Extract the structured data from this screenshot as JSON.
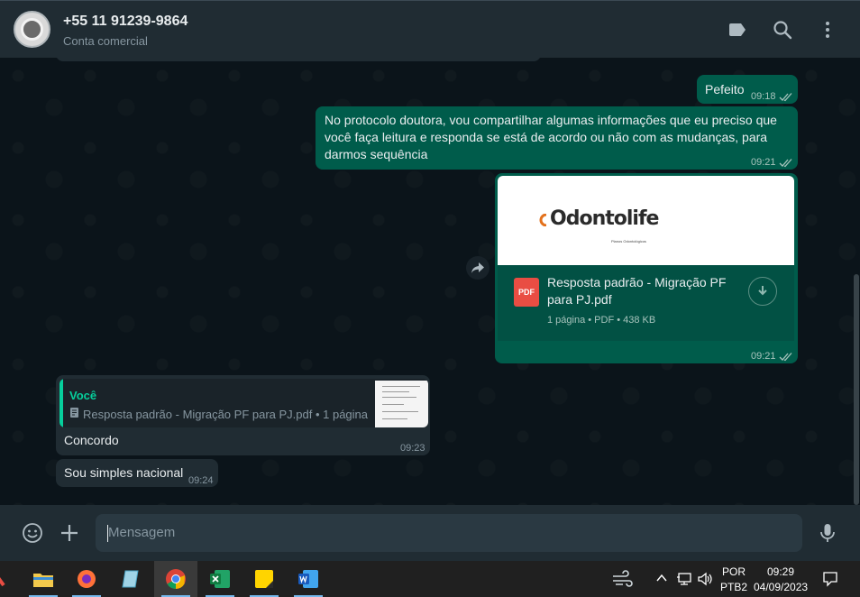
{
  "header": {
    "contact_name": "+55 11 91239-9864",
    "contact_subtitle": "Conta comercial",
    "icons": [
      "label-icon",
      "search-icon",
      "menu-icon"
    ]
  },
  "messages": {
    "m1": {
      "text": "Pefeito",
      "time": "09:18"
    },
    "m2": {
      "text": "No protocolo doutora, vou compartilhar algumas informações que eu preciso que você faça leitura e responda se está de acordo ou não com as mudanças, para darmos sequência",
      "time": "09:21"
    },
    "m3": {
      "logo_text": "Odontolife",
      "logo_sub": "Planos Odontológicos",
      "file_name": "Resposta padrão - Migração PF para PJ.pdf",
      "file_info": "1 página • PDF • 438 KB",
      "file_type": "PDF",
      "time": "09:21"
    },
    "m4": {
      "quote_author": "Você",
      "quote_text": "Resposta padrão - Migração PF para PJ.pdf • 1 página",
      "text": "Concordo",
      "time": "09:23"
    },
    "m5": {
      "text": "Sou simples nacional",
      "time": "09:24"
    }
  },
  "composer": {
    "placeholder": "Mensagem"
  },
  "taskbar": {
    "lang": "POR",
    "layout": "PTB2",
    "time": "09:29",
    "date": "04/09/2023"
  },
  "colors": {
    "outgoing": "#005c4b",
    "incoming": "#202c33",
    "accent": "#06cf9c",
    "background": "#0b141a"
  }
}
